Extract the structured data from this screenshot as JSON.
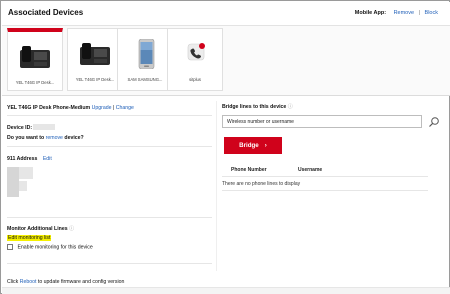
{
  "header": {
    "title": "Associated Devices",
    "mobile_app_label": "Mobile App:",
    "remove_link": "Remove",
    "separator": "|",
    "block_link": "Block"
  },
  "devices": [
    {
      "caption": "YEL T46G IP Desk...",
      "icon": "desk-phone-icon",
      "selected": true
    },
    {
      "caption": "YEL T46G IP Desk...",
      "icon": "desk-phone-icon",
      "selected": false
    },
    {
      "caption": "SAM SAMSUNG...",
      "icon": "smartphone-icon",
      "selected": false
    },
    {
      "caption": "sitplus",
      "icon": "app-icon",
      "selected": false
    }
  ],
  "device_detail": {
    "model_text": "YEL T46G IP Desk Phone-Medium",
    "upgrade_link": "Upgrade",
    "pipe": "|",
    "change_link": "Change",
    "device_id_label": "Device ID:",
    "remove_question_prefix": "Do you want to",
    "remove_question_link": "remove",
    "remove_question_suffix": "device?",
    "address_label": "911 Address",
    "address_edit_link": "Edit",
    "monitor_heading": "Monitor Additional Lines",
    "edit_monitoring_link": "Edit monitoring list",
    "enable_monitoring_label": "Enable monitoring for this device",
    "reboot_prefix": "Click",
    "reboot_link": "Reboot",
    "reboot_suffix": "to update firmware and config version"
  },
  "bridge": {
    "heading": "Bridge lines to this device",
    "input_placeholder": "Wireless number or username",
    "button_label": "Bridge",
    "button_chevron": "›",
    "col_phone": "Phone Number",
    "col_user": "Username",
    "empty_text": "There are no phone lines to display"
  },
  "colors": {
    "accent_red": "#d0021b",
    "link_blue": "#1f5fb8",
    "highlight_yellow": "#f5f000"
  }
}
